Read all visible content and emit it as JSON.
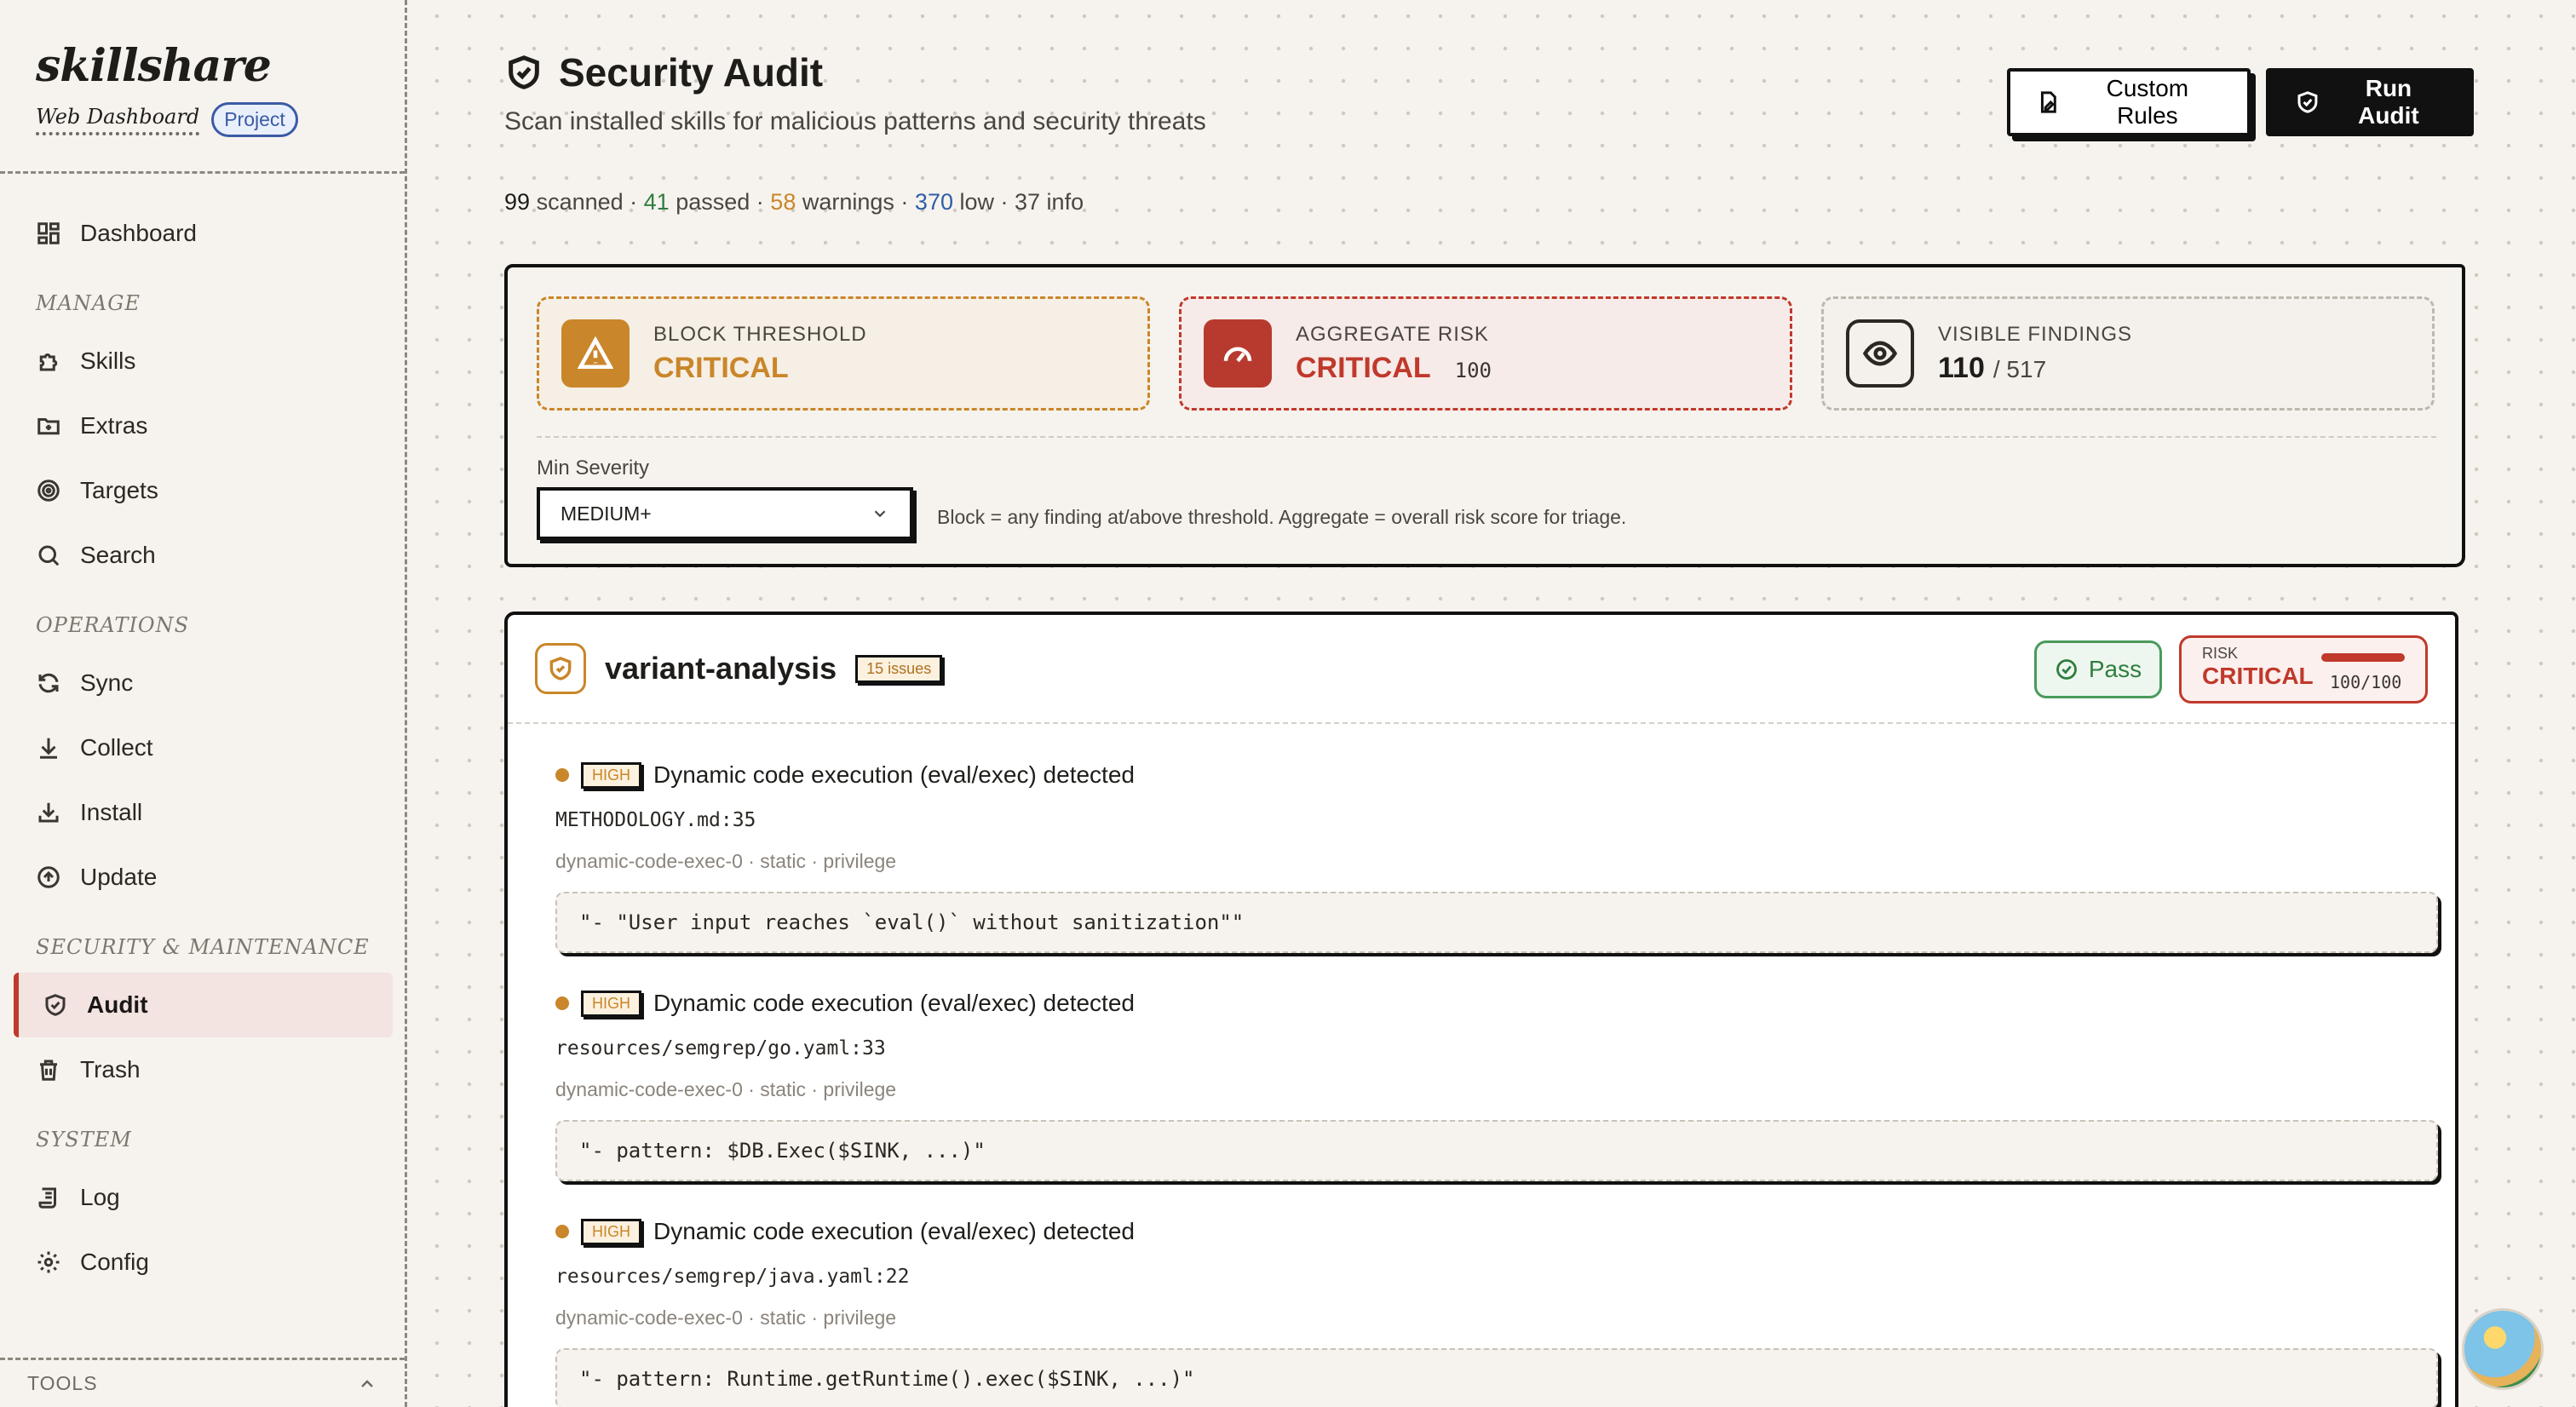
{
  "brand": {
    "name": "skillshare",
    "subtitle": "Web Dashboard",
    "badge": "Project"
  },
  "sidebar": {
    "dashboard": "Dashboard",
    "manage_title": "MANAGE",
    "manage": [
      "Skills",
      "Extras",
      "Targets",
      "Search"
    ],
    "operations_title": "OPERATIONS",
    "operations": [
      "Sync",
      "Collect",
      "Install",
      "Update"
    ],
    "security_title": "SECURITY & MAINTENANCE",
    "security": [
      "Audit",
      "Trash"
    ],
    "system_title": "SYSTEM",
    "system": [
      "Log",
      "Config"
    ],
    "tools": "TOOLS"
  },
  "header": {
    "title": "Security Audit",
    "subtitle": "Scan installed skills for malicious patterns and security threats",
    "custom_rules": "Custom Rules",
    "run_audit": "Run Audit"
  },
  "stats": {
    "scanned": "99",
    "scanned_label": "scanned",
    "passed": "41",
    "passed_label": "passed",
    "warnings": "58",
    "warnings_label": "warnings",
    "low": "370",
    "low_label": "low",
    "info": "37 info"
  },
  "summary": {
    "block_label": "BLOCK THRESHOLD",
    "block_value": "CRITICAL",
    "risk_label": "AGGREGATE RISK",
    "risk_value": "CRITICAL",
    "risk_score": "100",
    "visible_label": "VISIBLE FINDINGS",
    "visible_count": "110",
    "visible_total": "/ 517",
    "min_severity_label": "Min Severity",
    "min_severity_value": "MEDIUM+",
    "help": "Block = any finding at/above threshold. Aggregate = overall risk score for triage."
  },
  "skill": {
    "name": "variant-analysis",
    "issues": "15 issues",
    "pass": "Pass",
    "risk_label": "RISK",
    "risk_value": "CRITICAL",
    "risk_score": "100/100",
    "risk_fraction": 1.0,
    "findings": [
      {
        "severity": "HIGH",
        "title": "Dynamic code execution (eval/exec) detected",
        "file": "METHODOLOGY.md:35",
        "meta": "dynamic-code-exec-0 · static · privilege",
        "code": "\"- \"User input reaches `eval()` without sanitization\"\""
      },
      {
        "severity": "HIGH",
        "title": "Dynamic code execution (eval/exec) detected",
        "file": "resources/semgrep/go.yaml:33",
        "meta": "dynamic-code-exec-0 · static · privilege",
        "code": "\"- pattern: $DB.Exec($SINK, ...)\""
      },
      {
        "severity": "HIGH",
        "title": "Dynamic code execution (eval/exec) detected",
        "file": "resources/semgrep/java.yaml:22",
        "meta": "dynamic-code-exec-0 · static · privilege",
        "code": "\"- pattern: Runtime.getRuntime().exec($SINK, ...)\""
      }
    ]
  },
  "colors": {
    "accent": "#c0392b",
    "warning": "#c9862a",
    "success": "#2f7d3f",
    "info": "#2f5ea8"
  }
}
